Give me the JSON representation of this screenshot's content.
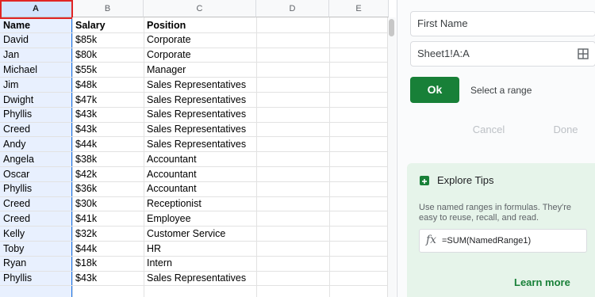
{
  "columns": [
    "A",
    "B",
    "C",
    "D",
    "E"
  ],
  "header_row": {
    "name": "Name",
    "salary": "Salary",
    "position": "Position"
  },
  "rows": [
    {
      "name": "David",
      "salary": "$85k",
      "position": "Corporate"
    },
    {
      "name": "Jan",
      "salary": "$80k",
      "position": "Corporate"
    },
    {
      "name": "Michael",
      "salary": "$55k",
      "position": "Manager"
    },
    {
      "name": "Jim",
      "salary": "$48k",
      "position": "Sales Representatives"
    },
    {
      "name": "Dwight",
      "salary": "$47k",
      "position": "Sales Representatives"
    },
    {
      "name": "Phyllis",
      "salary": "$43k",
      "position": "Sales Representatives"
    },
    {
      "name": "Creed",
      "salary": "$43k",
      "position": "Sales Representatives"
    },
    {
      "name": "Andy",
      "salary": "$44k",
      "position": "Sales Representatives"
    },
    {
      "name": "Angela",
      "salary": "$38k",
      "position": "Accountant"
    },
    {
      "name": "Oscar",
      "salary": "$42k",
      "position": "Accountant"
    },
    {
      "name": "Phyllis",
      "salary": "$36k",
      "position": "Accountant"
    },
    {
      "name": "Creed",
      "salary": "$30k",
      "position": "Receptionist"
    },
    {
      "name": "Creed",
      "salary": "$41k",
      "position": "Employee"
    },
    {
      "name": "Kelly",
      "salary": "$32k",
      "position": "Customer Service"
    },
    {
      "name": "Toby",
      "salary": "$44k",
      "position": "HR"
    },
    {
      "name": "Ryan",
      "salary": "$18k",
      "position": "Intern"
    },
    {
      "name": "Phyllis",
      "salary": "$43k",
      "position": "Sales Representatives"
    }
  ],
  "panel": {
    "name_field": "First Name",
    "range_field": "Sheet1!A:A",
    "ok_label": "Ok",
    "range_hint": "Select a range",
    "cancel_label": "Cancel",
    "done_label": "Done",
    "tips": {
      "title": "Explore Tips",
      "text": "Use named ranges in formulas. They're easy to reuse, recall, and read.",
      "formula": "=SUM(NamedRange1)",
      "fx_symbol": "fx",
      "learn_more": "Learn more"
    }
  },
  "colors": {
    "accent_green": "#188038",
    "selection_blue": "#e8f0fe",
    "outline_red": "#e02424"
  }
}
